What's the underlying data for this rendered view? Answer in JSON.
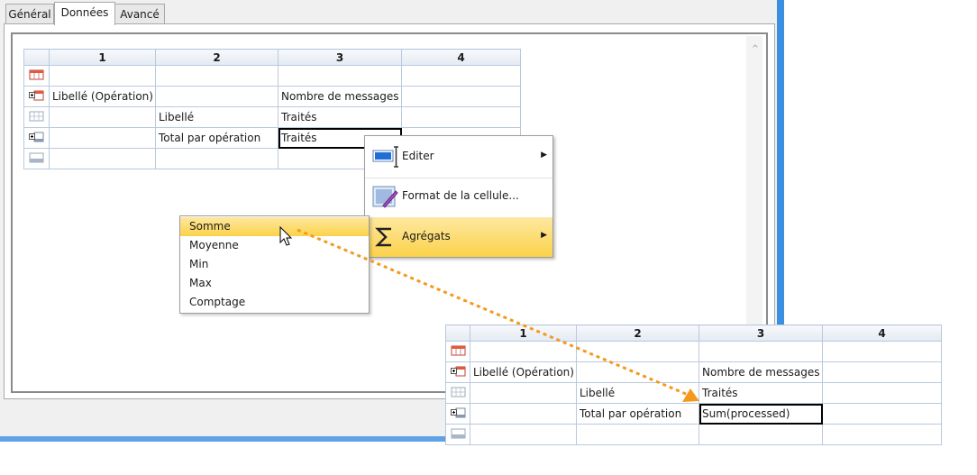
{
  "tabs": [
    {
      "label": "Général",
      "active": false
    },
    {
      "label": "Données",
      "active": true
    },
    {
      "label": "Avancé",
      "active": false
    }
  ],
  "grid_top": {
    "headers": [
      "1",
      "2",
      "3",
      "4"
    ],
    "rows": [
      {
        "icon": "header-row-icon",
        "cells": [
          "",
          "",
          "",
          ""
        ]
      },
      {
        "icon": "group-header-icon",
        "cells": [
          "Libellé (Opération)",
          "",
          "Nombre de messages",
          ""
        ]
      },
      {
        "icon": "detail-row-icon",
        "cells": [
          "",
          "Libellé",
          "Traités",
          ""
        ]
      },
      {
        "icon": "group-footer-icon",
        "cells": [
          "",
          "Total par opération",
          "Traités",
          ""
        ]
      },
      {
        "icon": "footer-row-icon",
        "cells": [
          "",
          "",
          "",
          ""
        ]
      }
    ]
  },
  "grid_bottom": {
    "headers": [
      "1",
      "2",
      "3",
      "4"
    ],
    "rows": [
      {
        "icon": "header-row-icon",
        "cells": [
          "",
          "",
          "",
          ""
        ]
      },
      {
        "icon": "group-header-icon",
        "cells": [
          "Libellé (Opération)",
          "",
          "Nombre de messages",
          ""
        ]
      },
      {
        "icon": "detail-row-icon",
        "cells": [
          "",
          "Libellé",
          "Traités",
          ""
        ]
      },
      {
        "icon": "group-footer-icon",
        "cells": [
          "",
          "Total par opération",
          "Sum(processed)",
          ""
        ]
      },
      {
        "icon": "footer-row-icon",
        "cells": [
          "",
          "",
          "",
          ""
        ]
      }
    ]
  },
  "context_menu": {
    "items": [
      {
        "label": "Editer",
        "icon": "edit-cell-icon",
        "submenu": true
      },
      {
        "label": "Format de la cellule...",
        "icon": "format-cell-icon",
        "submenu": false
      },
      {
        "label": "Agrégats",
        "icon": "sigma-icon",
        "submenu": true
      }
    ]
  },
  "aggregate_menu": {
    "items": [
      "Somme",
      "Moyenne",
      "Min",
      "Max",
      "Comptage"
    ]
  },
  "colors": {
    "accent_blue": "#3a8fe0",
    "highlight": "#fcd24a",
    "arrow_orange": "#f39a1e"
  }
}
